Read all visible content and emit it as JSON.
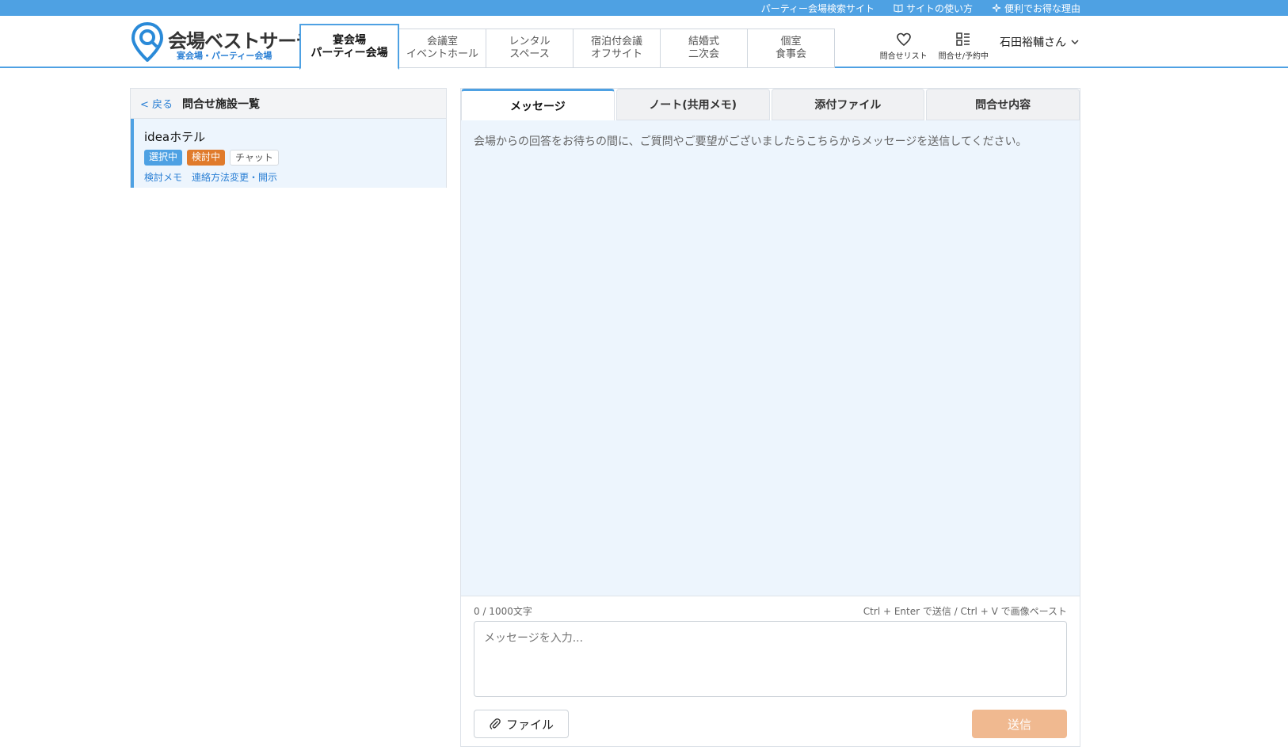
{
  "topbar": {
    "site_label": "パーティー会場検索サイト",
    "howto_label": "サイトの使い方",
    "benefit_label": "便利でお得な理由"
  },
  "logo": {
    "name": "会場ベストサーチ",
    "sub": "宴会場・パーティー会場"
  },
  "nav": [
    {
      "line1": "宴会場",
      "line2": "パーティー会場",
      "active": true
    },
    {
      "line1": "会議室",
      "line2": "イベントホール"
    },
    {
      "line1": "レンタル",
      "line2": "スペース"
    },
    {
      "line1": "宿泊付会議",
      "line2": "オフサイト"
    },
    {
      "line1": "結婚式",
      "line2": "二次会"
    },
    {
      "line1": "個室",
      "line2": "食事会"
    }
  ],
  "header_right": {
    "favorites_label": "問合せリスト",
    "inquiry_label": "問合せ/予約中",
    "user_name": "石田裕輔さん"
  },
  "left_panel": {
    "back_label": "< 戻る",
    "title": "問合せ施設一覧",
    "facility": {
      "name": "ideaホテル",
      "badges": [
        "選択中",
        "検討中",
        "チャット"
      ],
      "links": [
        "検討メモ",
        "連絡方法変更・開示"
      ]
    }
  },
  "tabs": [
    "メッセージ",
    "ノート(共用メモ)",
    "添付ファイル",
    "問合せ内容"
  ],
  "message_area": {
    "placeholder_text": "会場からの回答をお待ちの間に、ご質問やご要望がございましたらこちらからメッセージを送信してください。"
  },
  "composer": {
    "counter": "0 / 1000文字",
    "hint": "Ctrl + Enter で送信 / Ctrl + V で画像ペースト",
    "placeholder": "メッセージを入力...",
    "file_label": "ファイル",
    "send_label": "送信"
  },
  "colors": {
    "brand": "#4ea1e3",
    "badge_orange": "#e07b2c",
    "send_disabled": "#f0b990",
    "message_bg": "#edf5fd"
  }
}
